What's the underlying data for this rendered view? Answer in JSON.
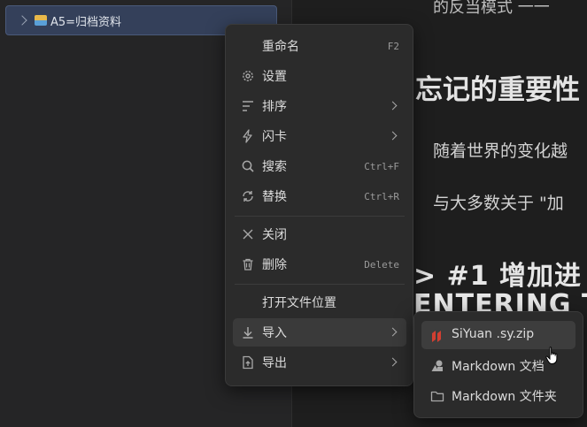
{
  "sidebar": {
    "tree": {
      "label": "A5=归档资料",
      "icon": "card-file-box-emoji-icon"
    }
  },
  "editor": {
    "line1": "的反当模式 一一",
    "heading": "忘记的重要性",
    "para1": "随着世界的变化越",
    "para2": "与大多数关于 \"加",
    "heading2_a": "> #1 增加进",
    "heading2_b": "ENTERING TI"
  },
  "menu": {
    "items": [
      {
        "label": "重命名",
        "shortcut": "F2",
        "icon": ""
      },
      {
        "label": "设置",
        "shortcut": "",
        "icon": "gear-icon"
      },
      {
        "label": "排序",
        "shortcut": "",
        "icon": "sort-icon"
      },
      {
        "label": "闪卡",
        "shortcut": "",
        "icon": "flash-icon"
      },
      {
        "label": "搜索",
        "shortcut": "Ctrl+F",
        "icon": "search-icon"
      },
      {
        "label": "替换",
        "shortcut": "Ctrl+R",
        "icon": "replace-icon"
      },
      {
        "label": "关闭",
        "shortcut": "",
        "icon": "close-icon"
      },
      {
        "label": "删除",
        "shortcut": "Delete",
        "icon": "trash-icon"
      },
      {
        "label": "打开文件位置",
        "shortcut": "",
        "icon": ""
      },
      {
        "label": "导入",
        "shortcut": "",
        "icon": "download-icon"
      },
      {
        "label": "导出",
        "shortcut": "",
        "icon": "export-icon"
      }
    ]
  },
  "submenu": {
    "items": [
      {
        "label": "SiYuan .sy.zip",
        "icon": "siyuan-logo-icon"
      },
      {
        "label": "Markdown 文档",
        "icon": "markdown-file-icon"
      },
      {
        "label": "Markdown 文件夹",
        "icon": "folder-icon"
      }
    ]
  },
  "colors": {
    "accent_selected": "#34405a",
    "menu_bg": "#2b2b2b",
    "siyuan_red": "#d23f31"
  }
}
